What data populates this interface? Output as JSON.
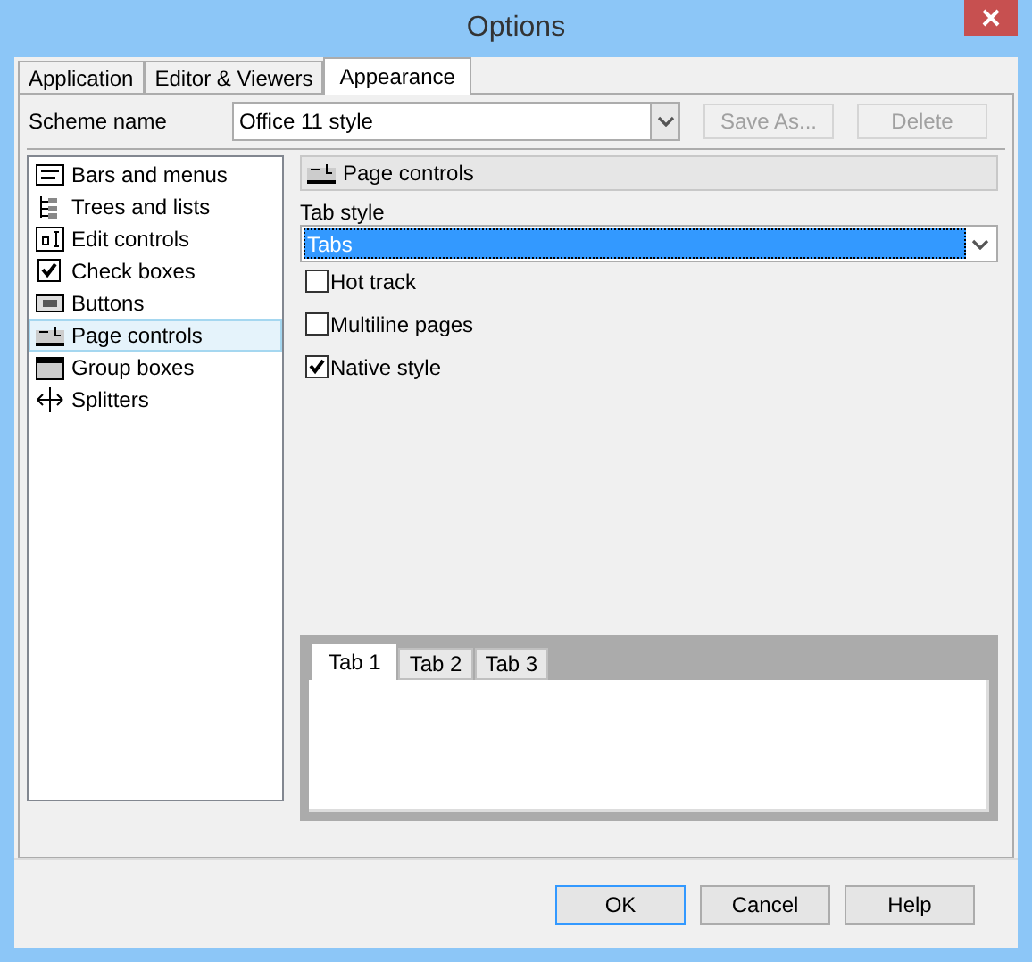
{
  "window": {
    "title": "Options"
  },
  "tabs": [
    {
      "label": "Application",
      "selected": false
    },
    {
      "label": "Editor & Viewers",
      "selected": false
    },
    {
      "label": "Appearance",
      "selected": true
    }
  ],
  "scheme": {
    "label": "Scheme name",
    "value": "Office 11 style",
    "buttons": [
      {
        "label": "Save As...",
        "disabled": true
      },
      {
        "label": "Delete",
        "disabled": true
      }
    ]
  },
  "sidebar": {
    "items": [
      {
        "label": "Bars and menus",
        "kind": "bars",
        "selected": false
      },
      {
        "label": "Trees and lists",
        "kind": "trees",
        "selected": false
      },
      {
        "label": "Edit controls",
        "kind": "edit",
        "selected": false
      },
      {
        "label": "Check boxes",
        "kind": "check",
        "selected": false
      },
      {
        "label": "Buttons",
        "kind": "button",
        "selected": false
      },
      {
        "label": "Page controls",
        "kind": "page",
        "selected": true
      },
      {
        "label": "Group boxes",
        "kind": "group",
        "selected": false
      },
      {
        "label": "Splitters",
        "kind": "splitter",
        "selected": false
      }
    ]
  },
  "panel": {
    "header": "Page controls",
    "tab_style_label": "Tab style",
    "tab_style_value": "Tabs",
    "options": [
      {
        "label": "Hot track",
        "checked": false
      },
      {
        "label": "Multiline pages",
        "checked": false
      },
      {
        "label": "Native style",
        "checked": true
      }
    ],
    "preview_tabs": [
      {
        "label": "Tab 1",
        "selected": true
      },
      {
        "label": "Tab 2",
        "selected": false
      },
      {
        "label": "Tab 3",
        "selected": false
      }
    ]
  },
  "buttons": [
    {
      "label": "OK",
      "default": true
    },
    {
      "label": "Cancel",
      "default": false
    },
    {
      "label": "Help",
      "default": false
    }
  ]
}
